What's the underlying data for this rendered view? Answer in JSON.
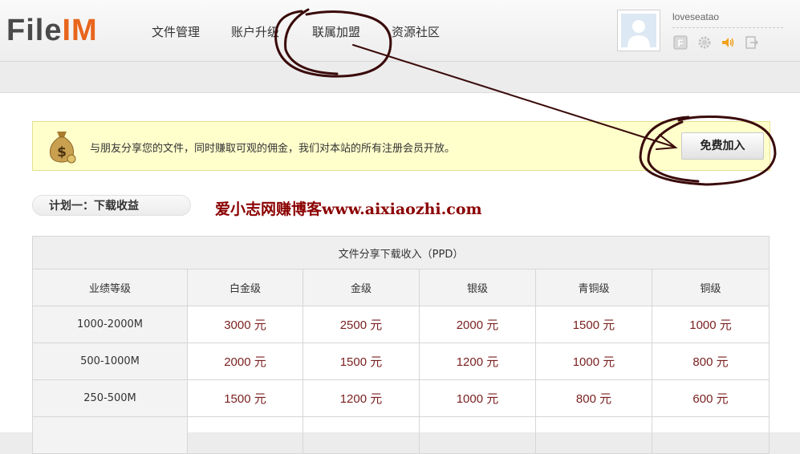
{
  "header": {
    "logo_part1": "File",
    "logo_part2": "IM",
    "nav": [
      "文件管理",
      "账户升级",
      "联属加盟",
      "资源社区"
    ],
    "username": "loveseatao",
    "user_icons": [
      "vip-f-icon",
      "gear-icon",
      "speaker-icon",
      "logout-icon"
    ]
  },
  "banner": {
    "text": "与朋友分享您的文件，同时赚取可观的佣金，我们对本站的所有注册会员开放。",
    "join_button": "免费加入"
  },
  "plan_tab": "计划一：下载收益",
  "watermark": "爱小志网赚博客www.aixiaozhi.com",
  "table": {
    "title": "文件分享下载收入（PPD）",
    "headers": [
      "业绩等级",
      "白金级",
      "金级",
      "银级",
      "青铜级",
      "铜级"
    ],
    "rows": [
      {
        "level": "1000-2000M",
        "values": [
          "3000 元",
          "2500 元",
          "2000 元",
          "1500 元",
          "1000 元"
        ]
      },
      {
        "level": "500-1000M",
        "values": [
          "2000 元",
          "1500 元",
          "1200 元",
          "1000 元",
          "800 元"
        ]
      },
      {
        "level": "250-500M",
        "values": [
          "1500 元",
          "1200 元",
          "1000 元",
          "800 元",
          "600 元"
        ]
      }
    ]
  },
  "colors": {
    "logo_accent": "#e8651c",
    "banner_bg": "#ffffcc",
    "amount_text": "#7a1f1f",
    "annotation_ink": "#3a0a0a"
  }
}
